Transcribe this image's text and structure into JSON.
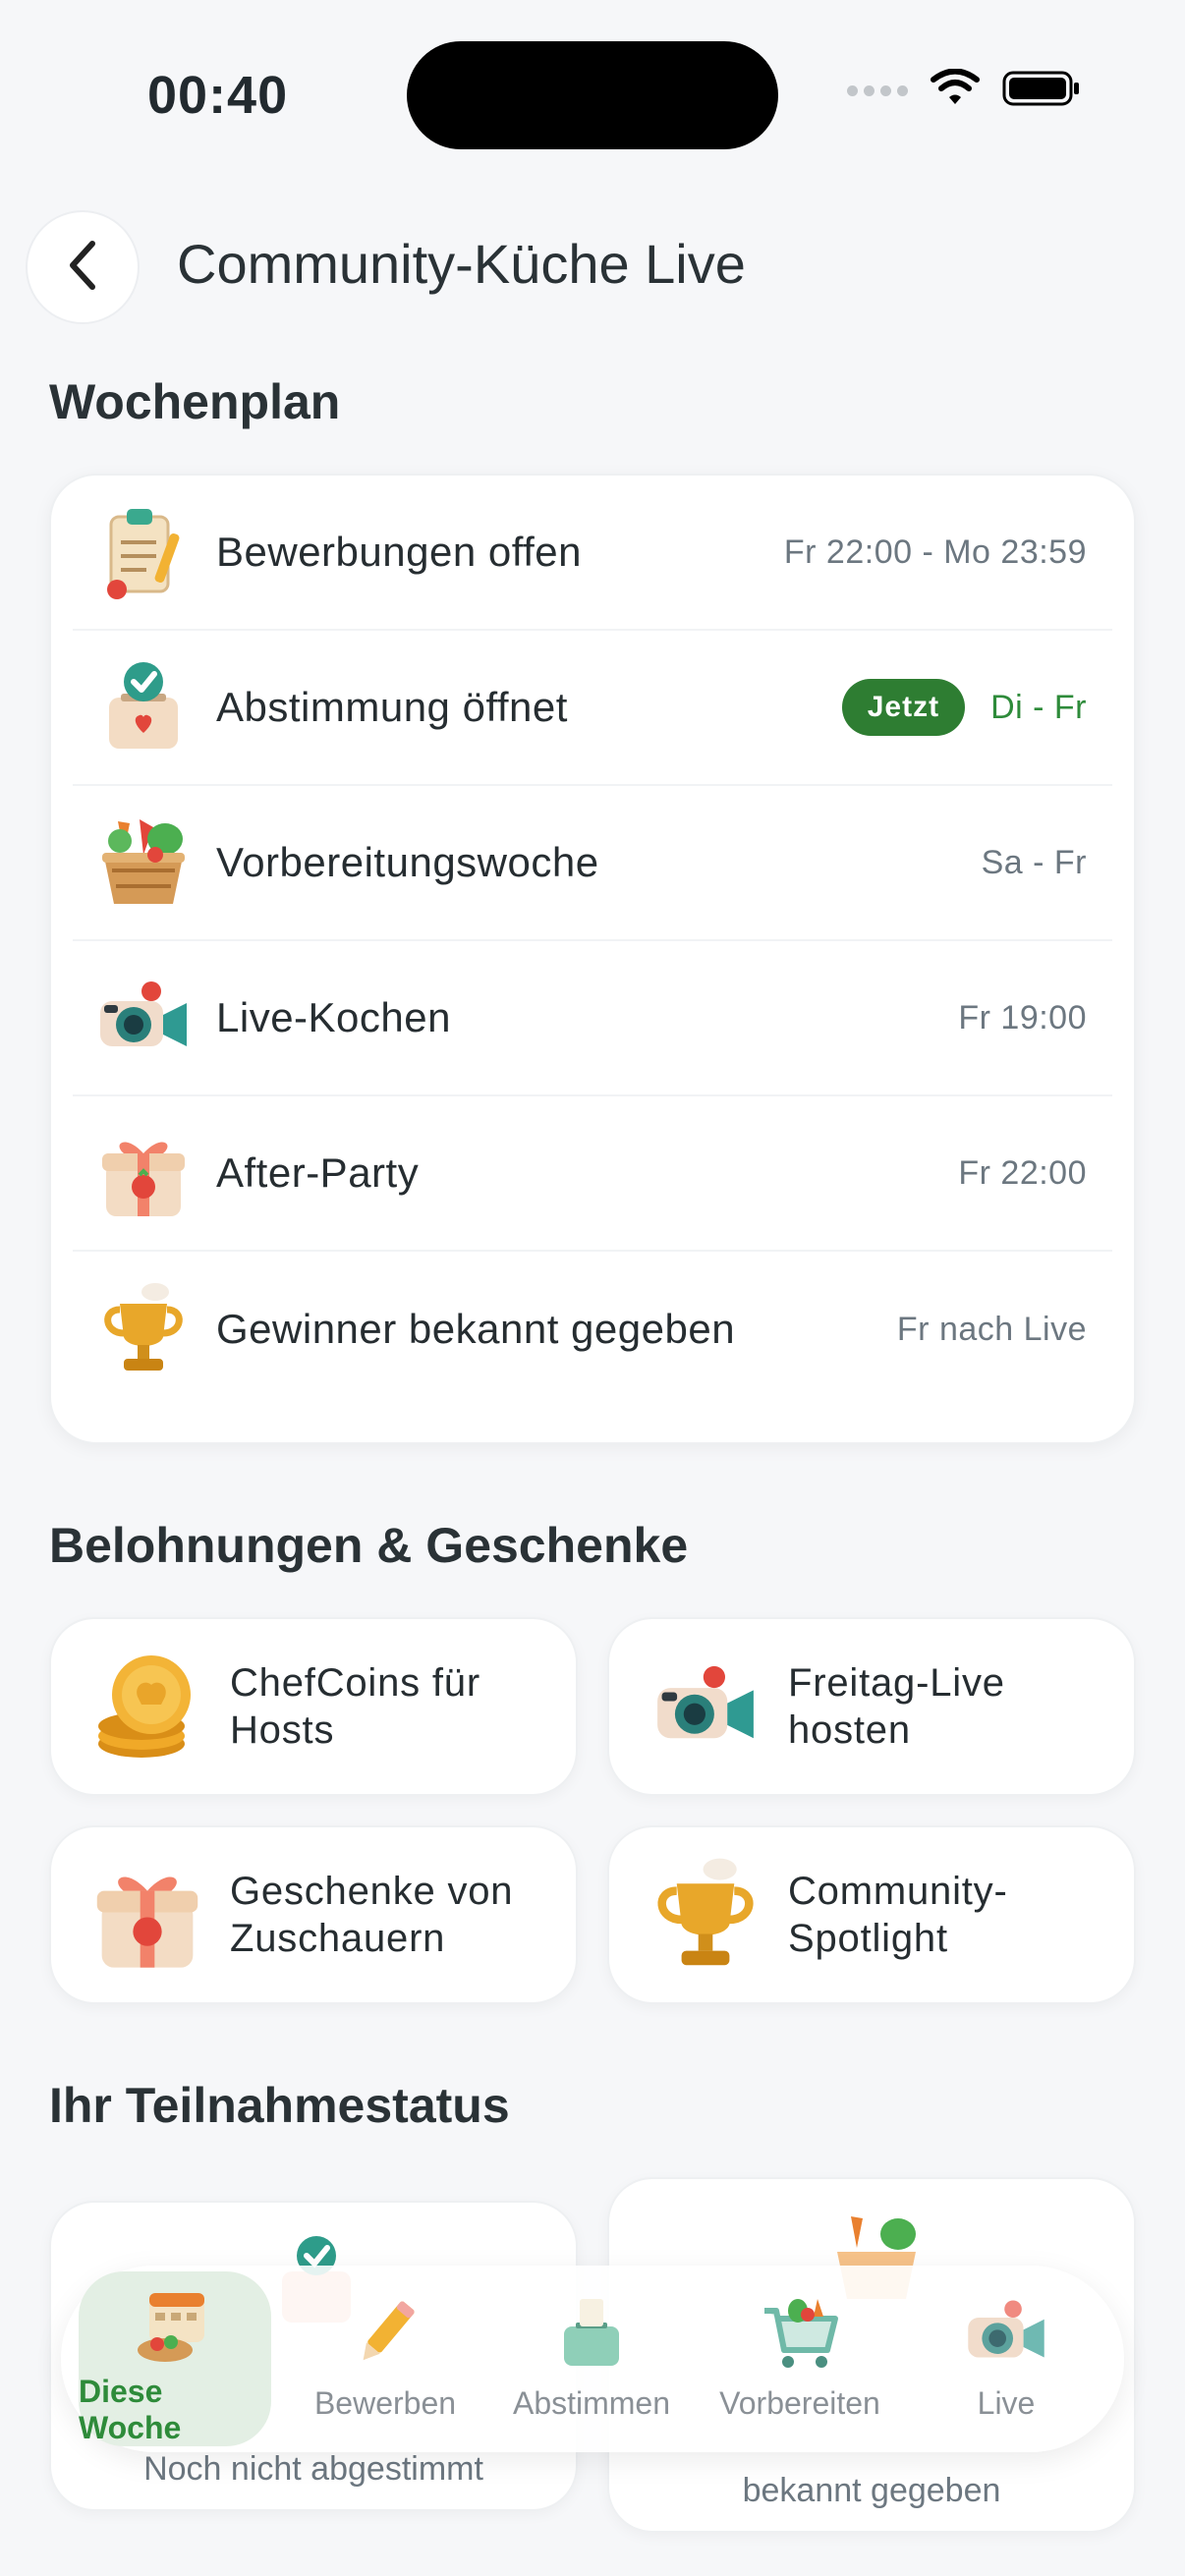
{
  "status_bar": {
    "time": "00:40"
  },
  "header": {
    "title": "Community-Küche Live"
  },
  "schedule": {
    "title": "Wochenplan",
    "items": [
      {
        "icon": "clipboard-icon",
        "label": "Bewerbungen offen",
        "time": "Fr 22:00 - Mo 23:59"
      },
      {
        "icon": "ballot-box-icon",
        "label": "Abstimmung öffnet",
        "badge": "Jetzt",
        "time": "Di - Fr"
      },
      {
        "icon": "vegetable-basket-icon",
        "label": "Vorbereitungswoche",
        "time": "Sa - Fr"
      },
      {
        "icon": "camera-icon",
        "label": "Live-Kochen",
        "time": "Fr 19:00"
      },
      {
        "icon": "gift-icon",
        "label": "After-Party",
        "time": "Fr 22:00"
      },
      {
        "icon": "trophy-icon",
        "label": "Gewinner bekannt gegeben",
        "time": "Fr nach Live"
      }
    ]
  },
  "rewards": {
    "title": "Belohnungen & Geschenke",
    "items": [
      {
        "icon": "coins-icon",
        "line1": "ChefCoins für",
        "line2": "Hosts"
      },
      {
        "icon": "camera-icon",
        "line1": "Freitag-Live",
        "line2": "hosten"
      },
      {
        "icon": "gift-icon",
        "line1": "Geschenke von",
        "line2": "Zuschauern"
      },
      {
        "icon": "trophy-icon",
        "line1": "Community-",
        "line2": "Spotlight"
      }
    ]
  },
  "participation": {
    "title": "Ihr Teilnahmestatus",
    "cards": [
      {
        "icon": "ballot-box-icon",
        "subtitle": "Noch nicht abgestimmt"
      },
      {
        "icon": "vegetable-basket-icon",
        "subtitle": "bekannt gegeben"
      }
    ]
  },
  "bottom_nav": {
    "items": [
      {
        "icon": "calendar-meal-icon",
        "label": "Diese Woche",
        "active": true
      },
      {
        "icon": "pencil-icon",
        "label": "Bewerben"
      },
      {
        "icon": "ballot-box-icon",
        "label": "Abstimmen"
      },
      {
        "icon": "shopping-cart-icon",
        "label": "Vorbereiten"
      },
      {
        "icon": "camera-icon",
        "label": "Live"
      }
    ]
  },
  "colors": {
    "accent": "#2e7d32",
    "background": "#f6f7f9",
    "card": "#ffffff"
  }
}
